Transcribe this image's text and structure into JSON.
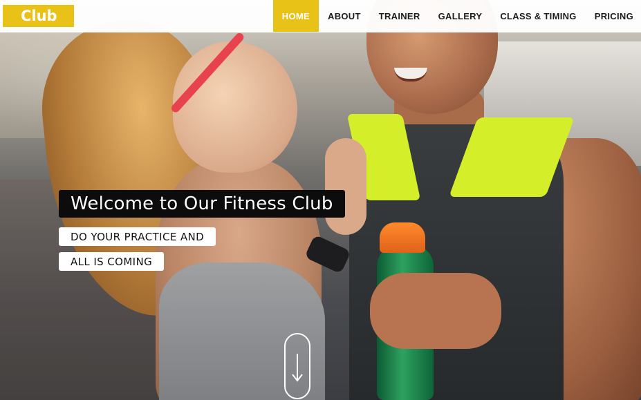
{
  "brand": {
    "logo_text": "Club",
    "accent_color": "#e8c217"
  },
  "nav": {
    "items": [
      {
        "label": "HOME",
        "active": true
      },
      {
        "label": "ABOUT",
        "active": false
      },
      {
        "label": "TRAINER",
        "active": false
      },
      {
        "label": "GALLERY",
        "active": false
      },
      {
        "label": "CLASS & TIMING",
        "active": false
      },
      {
        "label": "PRICING",
        "active": false
      }
    ]
  },
  "hero": {
    "headline": "Welcome to Our Fitness Club",
    "tagline_line1": "DO YOUR PRACTICE AND",
    "tagline_line2": "ALL IS COMING",
    "scroll_icon": "arrow-down-icon"
  }
}
